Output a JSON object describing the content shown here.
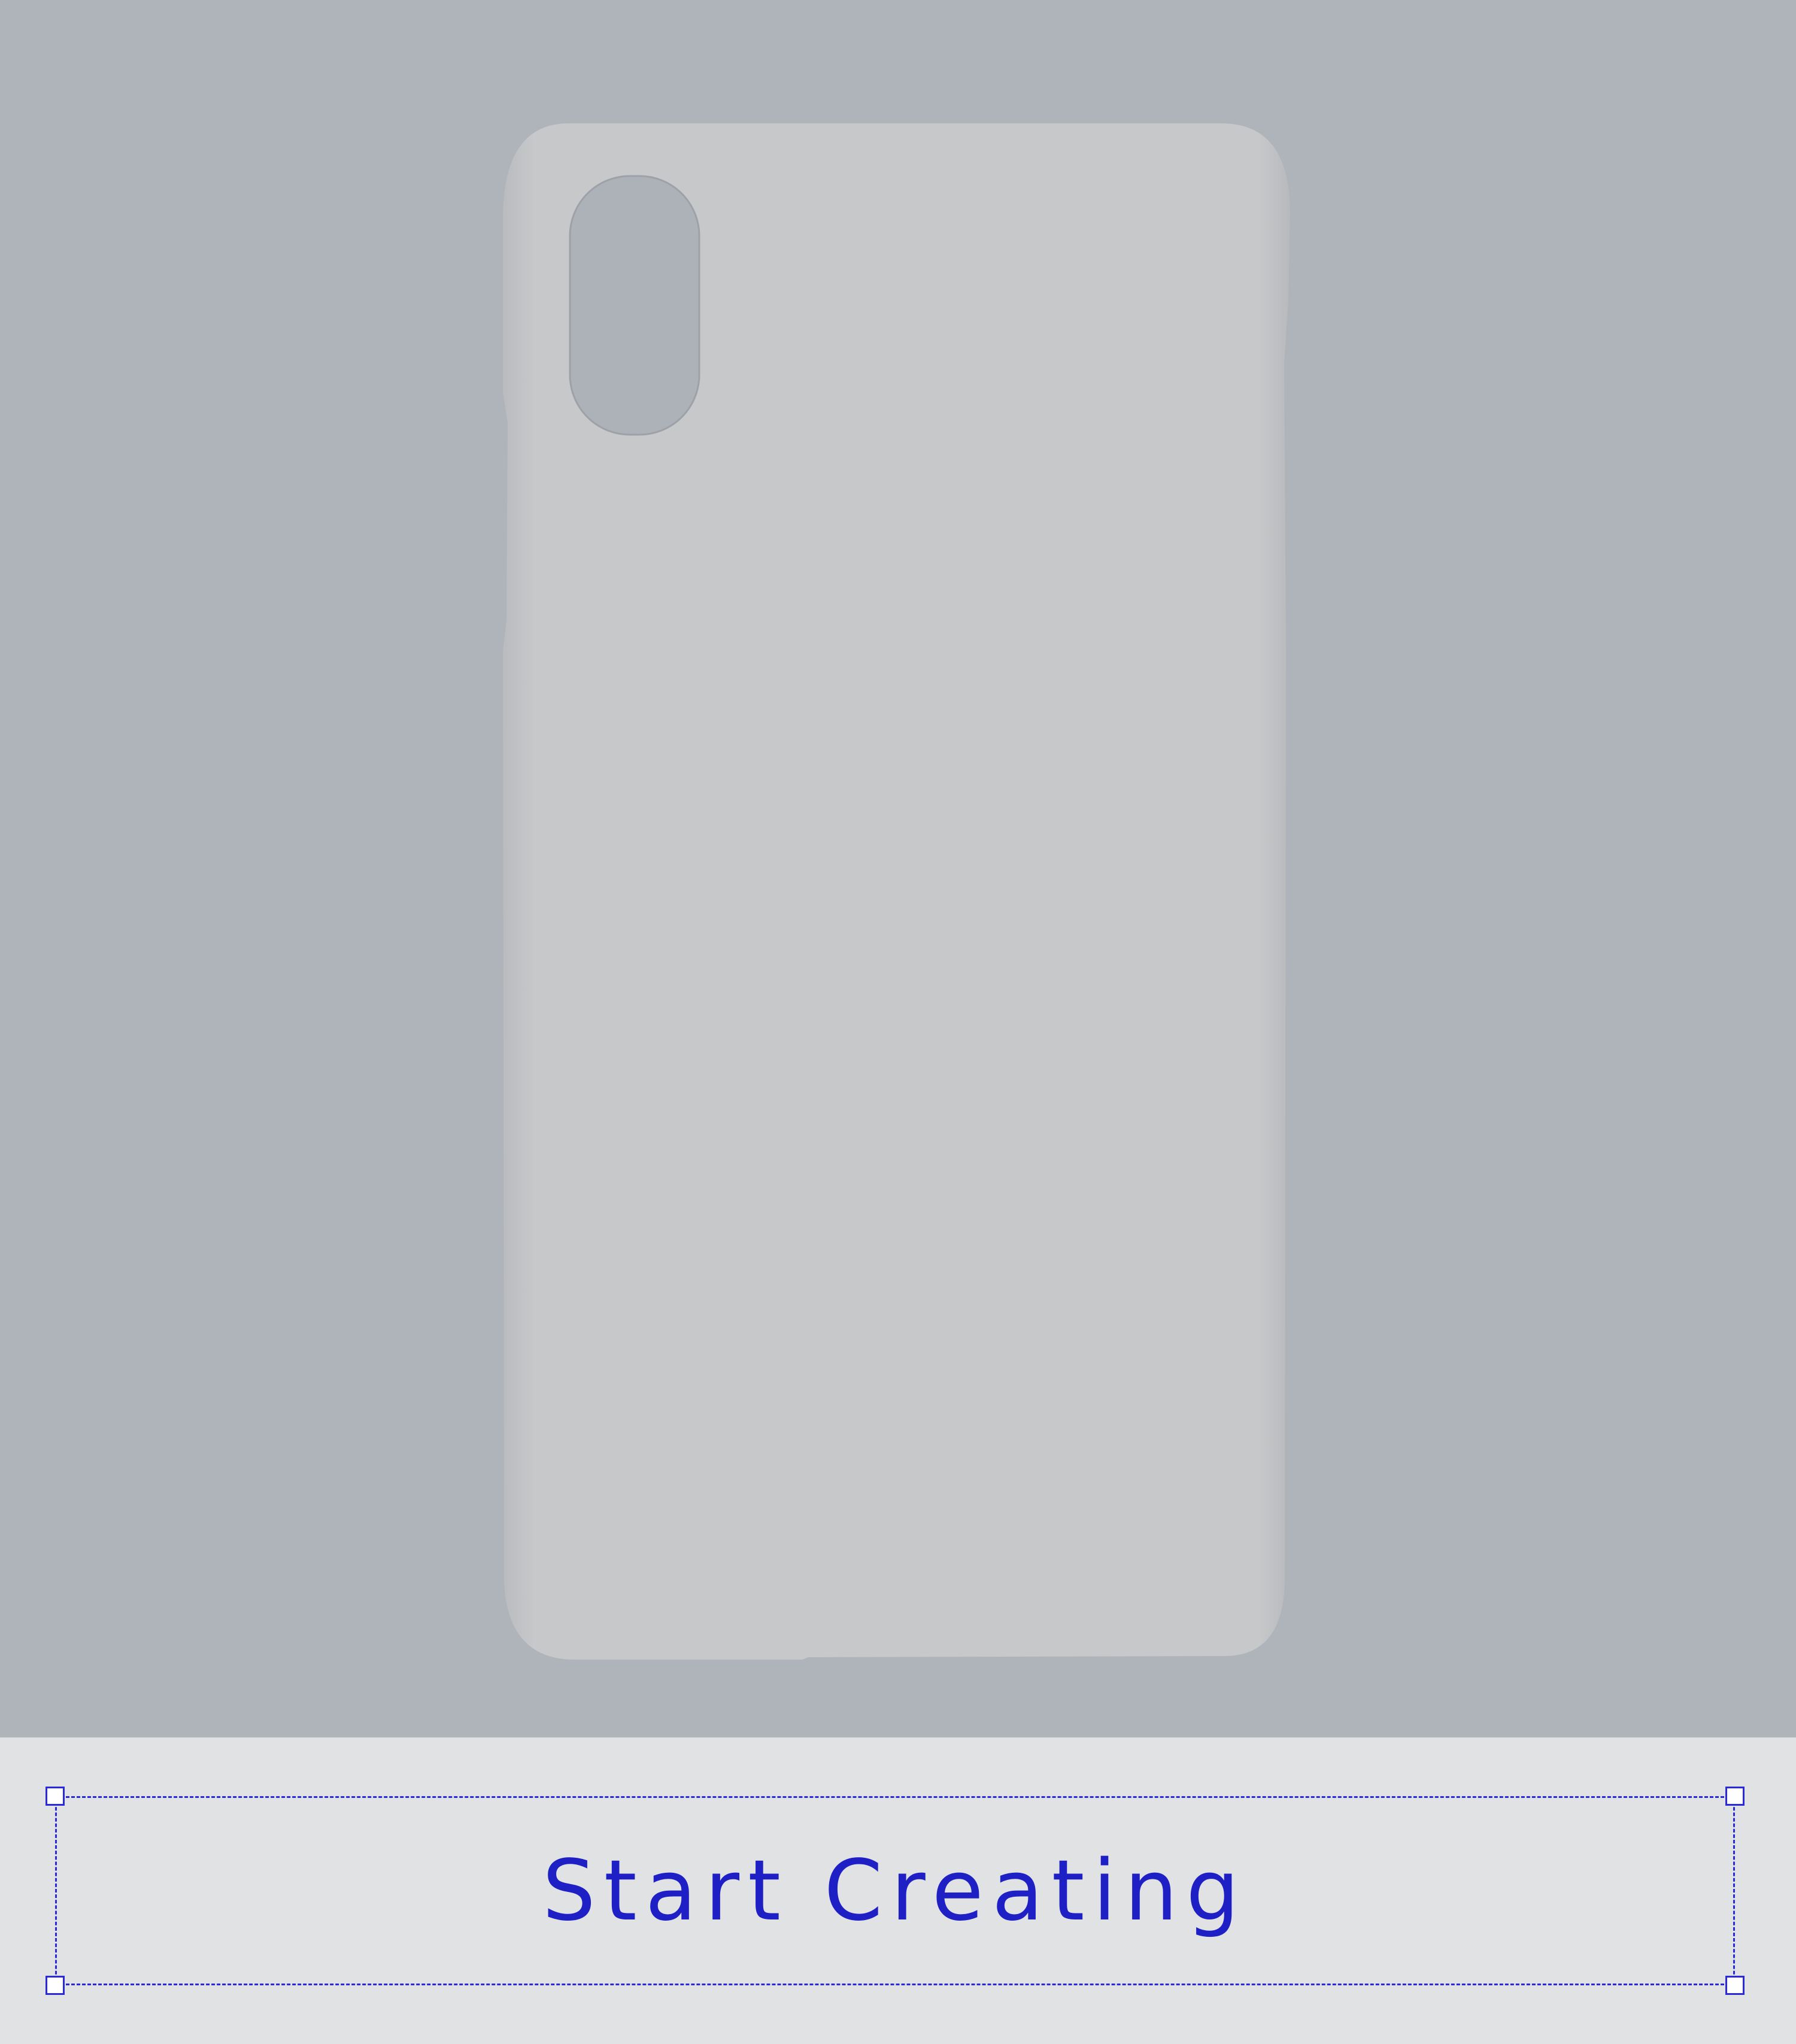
{
  "editor": {
    "product": "phone-case-icon",
    "cta": {
      "label": "Start Creating"
    }
  },
  "colors": {
    "stage_background": "#afb3ba",
    "case_fill": "#c6c8ca",
    "camera_cutout": "#adb1b8",
    "bottom_bar": "#e0e2e4",
    "accent": "#1f1fc6"
  }
}
